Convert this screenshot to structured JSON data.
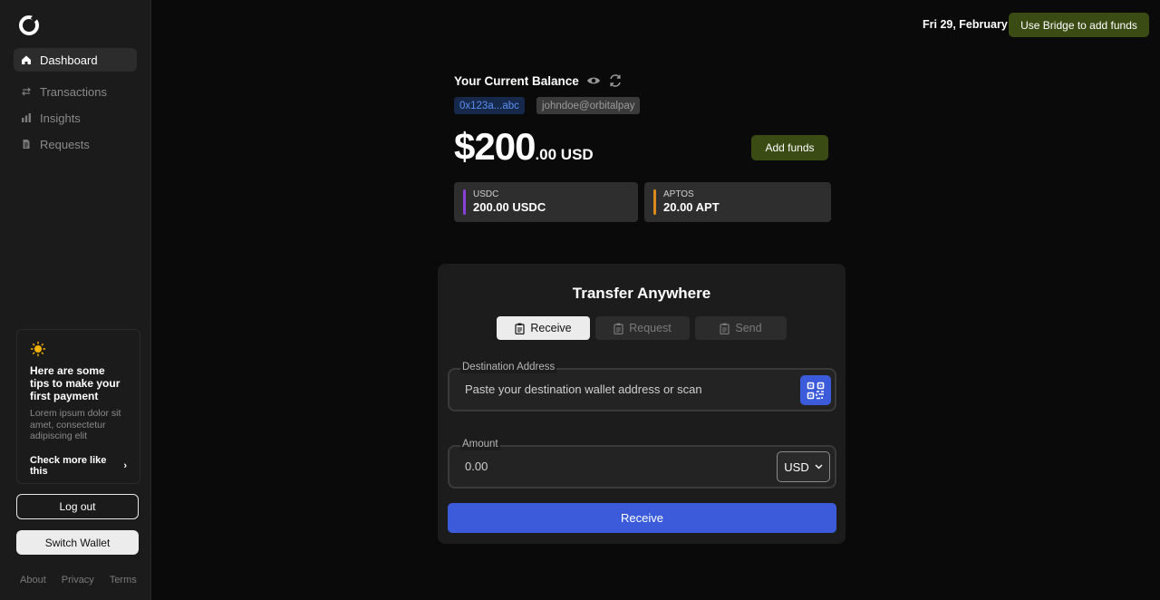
{
  "sidebar": {
    "nav": [
      {
        "label": "Dashboard",
        "icon": "home-icon"
      },
      {
        "label": "Transactions",
        "icon": "arrows-icon"
      },
      {
        "label": "Insights",
        "icon": "bar-chart-icon"
      },
      {
        "label": "Requests",
        "icon": "document-icon"
      }
    ],
    "tips": {
      "title": "Here are some tips to make your first payment",
      "body": "Lorem ipsum dolor sit amet, consectetur adipiscing elit",
      "link": "Check more like this"
    },
    "logout_label": "Log out",
    "switch_wallet_label": "Switch Wallet",
    "footer": [
      "About",
      "Privacy",
      "Terms"
    ]
  },
  "header": {
    "date": "Fri 29, February",
    "bridge_label": "Use Bridge to add funds"
  },
  "balance": {
    "title": "Your Current Balance",
    "address": "0x123a...abc",
    "email": "johndoe@orbitalpay",
    "amount_whole": "$200",
    "amount_fraction": ".00 USD",
    "add_funds_label": "Add funds",
    "tokens": [
      {
        "label": "USDC",
        "value": "200.00 USDC",
        "color": "#8b3fd9"
      },
      {
        "label": "APTOS",
        "value": "20.00 APT",
        "color": "#d98a1c"
      }
    ]
  },
  "transfer": {
    "title": "Transfer Anywhere",
    "tabs": [
      {
        "label": "Receive",
        "active": true
      },
      {
        "label": "Request",
        "active": false
      },
      {
        "label": "Send",
        "active": false
      }
    ],
    "destination": {
      "label": "Destination Address",
      "placeholder": "Paste your destination wallet address or scan"
    },
    "amount": {
      "label": "Amount",
      "value": "0.00",
      "currency": "USD"
    },
    "submit_label": "Receive"
  },
  "colors": {
    "accent_blue": "#3b5bdb",
    "accent_olive": "#3a4b14"
  }
}
